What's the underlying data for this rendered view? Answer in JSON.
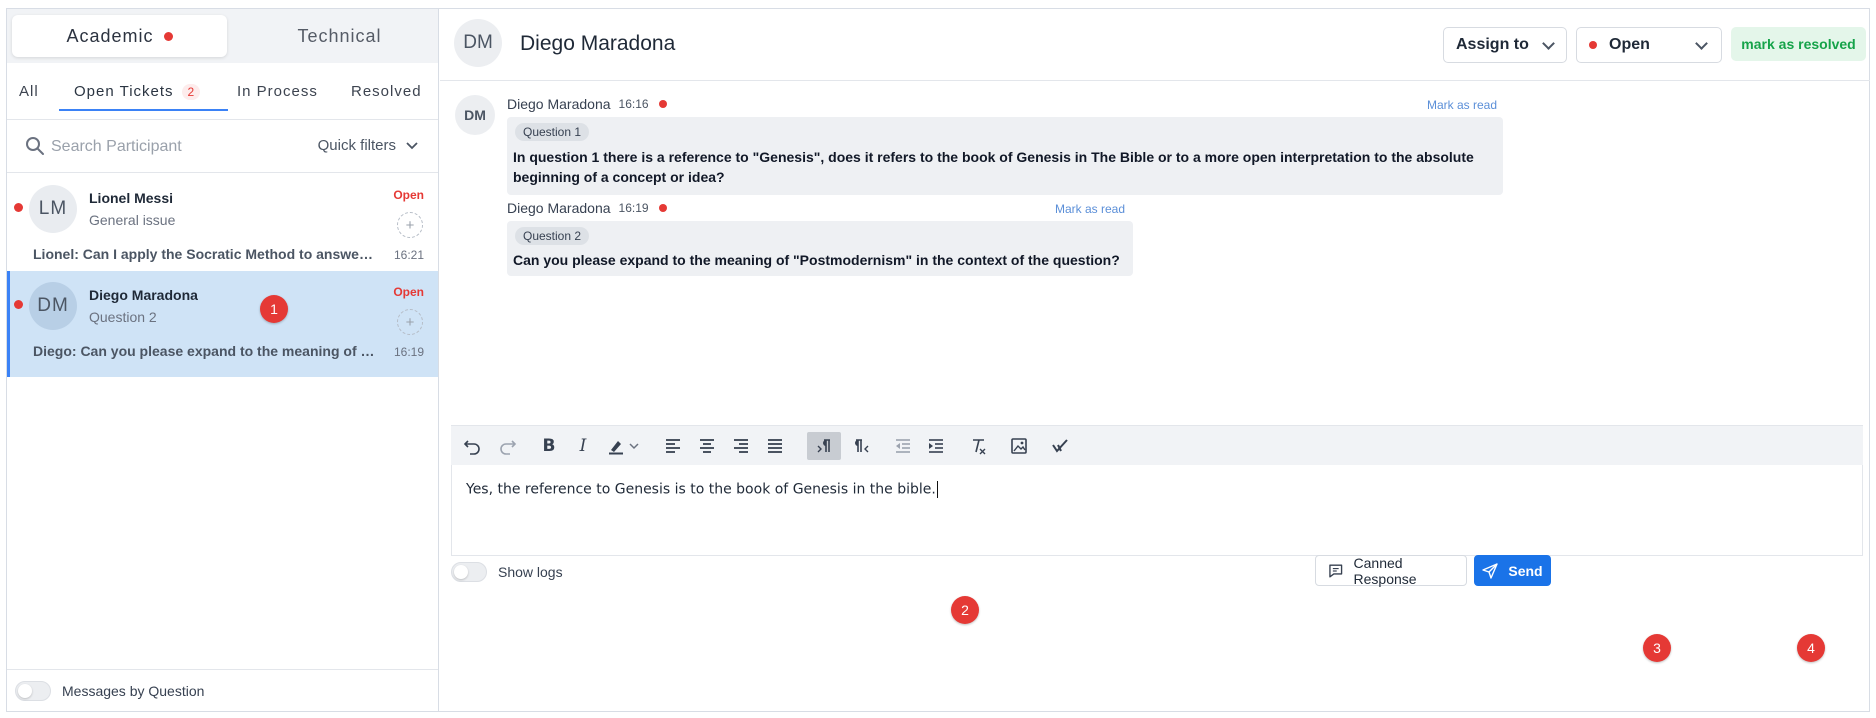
{
  "categories": {
    "academic": "Academic",
    "technical": "Technical"
  },
  "status_tabs": {
    "all": "All",
    "open": "Open Tickets",
    "open_count": "2",
    "in_process": "In Process",
    "resolved": "Resolved"
  },
  "search": {
    "placeholder": "Search Participant",
    "quick_filters": "Quick filters"
  },
  "tickets": [
    {
      "initials": "LM",
      "name": "Lionel Messi",
      "subtitle": "General issue",
      "status": "Open",
      "preview": "Lionel: Can I apply the Socratic Method to answer the question?",
      "time": "16:21"
    },
    {
      "initials": "DM",
      "name": "Diego Maradona",
      "subtitle": "Question 2",
      "status": "Open",
      "preview": "Diego: Can you please expand to the meaning of \"Postmodernism\" in the context of the question?",
      "time": "16:19"
    }
  ],
  "left_footer": {
    "toggle_label": "Messages by Question"
  },
  "header": {
    "initials": "DM",
    "name": "Diego Maradona",
    "assign_label": "Assign to",
    "status_label": "Open",
    "resolve_label": "mark as resolved"
  },
  "messages": [
    {
      "initials": "DM",
      "author": "Diego Maradona",
      "time": "16:16",
      "mark_read": "Mark as read",
      "question": "Question 1",
      "text_line1": "In question 1 there is a reference to \"Genesis\", does it refers to the book of Genesis in The Bible or to a more open interpretation to the absolute",
      "text_line2": "beginning of a concept or idea?"
    },
    {
      "author": "Diego Maradona",
      "time": "16:19",
      "mark_read": "Mark as read",
      "question": "Question 2",
      "text_line1": "Can you please expand to the meaning of \"Postmodernism\" in the context of the question?"
    }
  ],
  "editor": {
    "text": "Yes, the reference to Genesis is to the book of Genesis in the bible."
  },
  "footer": {
    "show_logs": "Show logs",
    "canned_response": "Canned Response",
    "send": "Send"
  },
  "markers": [
    "1",
    "2",
    "3",
    "4"
  ],
  "colors": {
    "accent": "#1a73e8",
    "unread": "#e53935",
    "resolve_green": "#16a34a",
    "selected_row": "#cfe3f6"
  }
}
